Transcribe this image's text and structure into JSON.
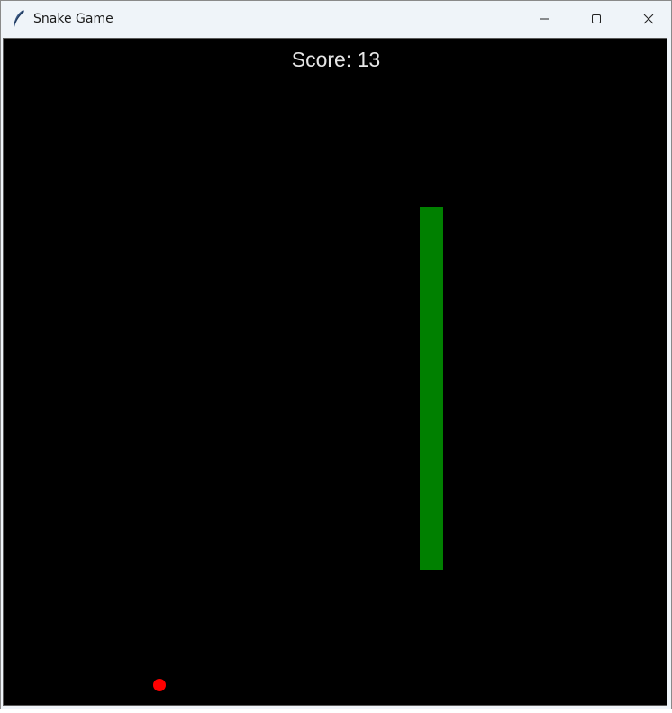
{
  "window": {
    "title": "Snake Game",
    "icon": "feather-icon",
    "controls": [
      "minimize-icon",
      "maximize-icon",
      "close-icon"
    ]
  },
  "game": {
    "score_label": "Score: 13",
    "score": 13,
    "background_color": "#000000",
    "snake_color": "#008000",
    "food_color": "#ff0000",
    "text_color": "#e6e6e6"
  }
}
